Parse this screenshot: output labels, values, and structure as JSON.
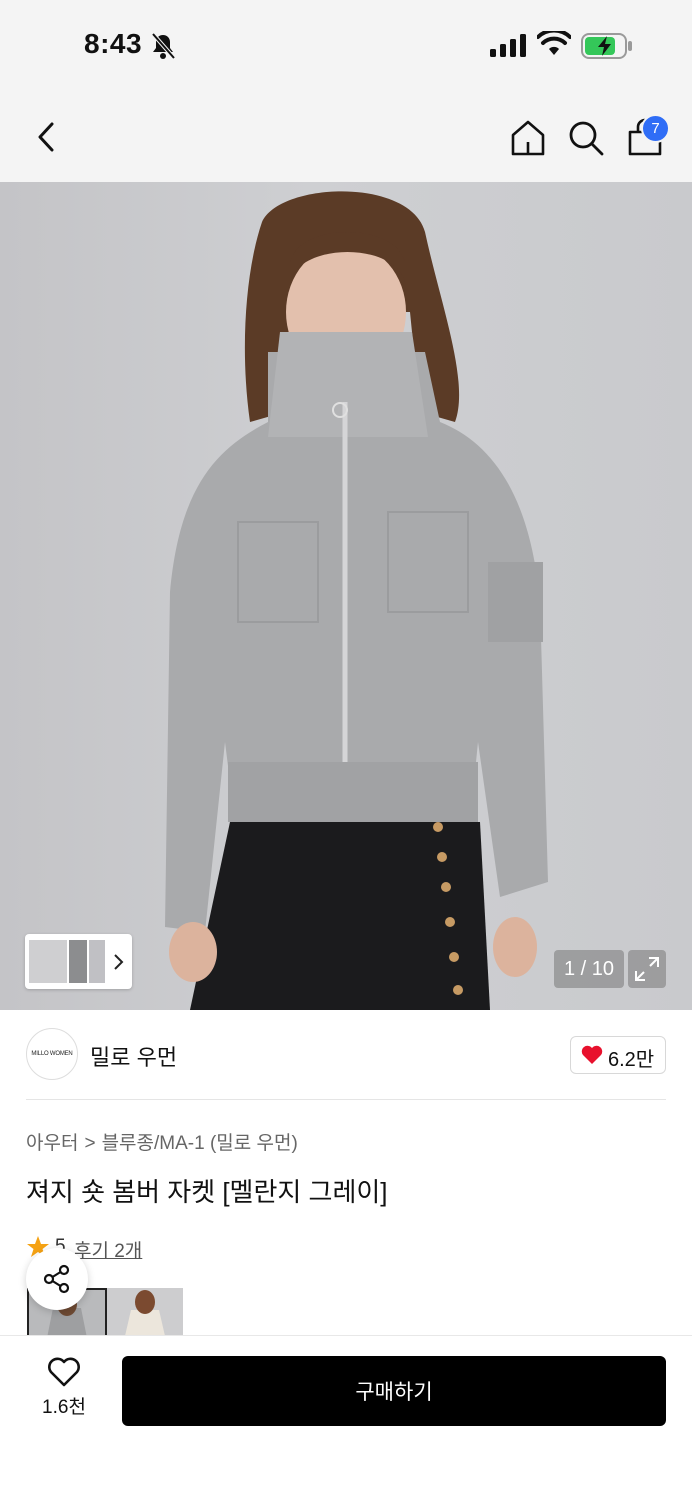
{
  "status_bar": {
    "time": "8:43"
  },
  "nav": {
    "cart_badge": "7"
  },
  "gallery": {
    "counter": "1 / 10"
  },
  "brand": {
    "logo_text": "MILLO WOMEN",
    "name": "밀로 우먼",
    "like_count": "6.2만"
  },
  "breadcrumb": {
    "category": "아우터",
    "separator": ">",
    "subcategory": "블루종/MA-1 (밀로 우먼)"
  },
  "product": {
    "title": "져지 숏 봄버 자켓 [멜란지 그레이]"
  },
  "rating": {
    "score": "5",
    "reviews": "후기 2개"
  },
  "bottom_bar": {
    "wish_count": "1.6천",
    "buy_label": "구매하기"
  },
  "colors": {
    "accent_blue": "#2f6df6",
    "heart_red": "#e8112d",
    "star_orange": "#f5a213"
  },
  "icons": [
    "back-icon",
    "home-icon",
    "search-icon",
    "cart-icon",
    "expand-icon",
    "heart-icon",
    "star-icon",
    "share-icon",
    "chevron-right-icon"
  ]
}
